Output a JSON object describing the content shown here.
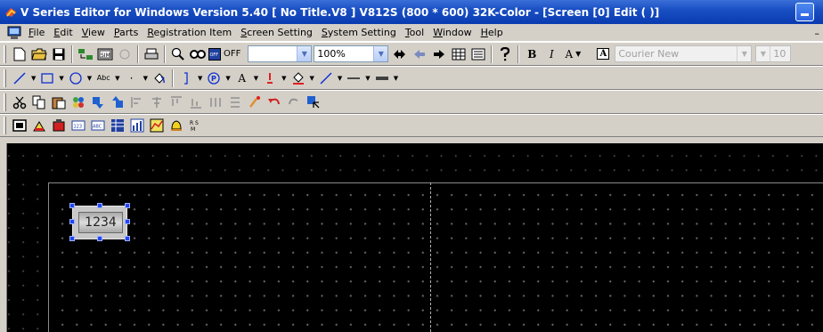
{
  "window": {
    "title": "V Series Editor for Windows Version 5.40 [ No Title.V8 ] V812S (800 * 600) 32K-Color - [Screen [0] Edit (          )]"
  },
  "menu": {
    "items": [
      {
        "underline": "F",
        "rest": "ile"
      },
      {
        "underline": "E",
        "rest": "dit"
      },
      {
        "underline": "V",
        "rest": "iew"
      },
      {
        "underline": "P",
        "rest": "arts"
      },
      {
        "underline": "R",
        "rest": "egistration Item"
      },
      {
        "underline": "S",
        "rest": "creen Setting"
      },
      {
        "underline": "S",
        "rest": "ystem Setting"
      },
      {
        "underline": "T",
        "rest": "ool"
      },
      {
        "underline": "W",
        "rest": "indow"
      },
      {
        "underline": "H",
        "rest": "elp"
      }
    ]
  },
  "toolbar1": {
    "off_label": "OFF",
    "zoom_value": "100%",
    "bold_label": "B",
    "italic_label": "I",
    "font_a_label": "A",
    "font_box_label": "A",
    "font_name": "Courier New",
    "font_size": "10"
  },
  "toolbar2": {
    "text_abc": "Abc",
    "p_label": "P",
    "a_label": "A"
  },
  "toolbar4": {
    "num_icon_label": "123",
    "abc_icon_label": "ABC"
  },
  "canvas": {
    "numeric_display_value": "1234"
  },
  "colors": {
    "title_bar": "#1a4fc4",
    "canvas_bg": "#000000",
    "selection_handle": "#2048f0"
  }
}
